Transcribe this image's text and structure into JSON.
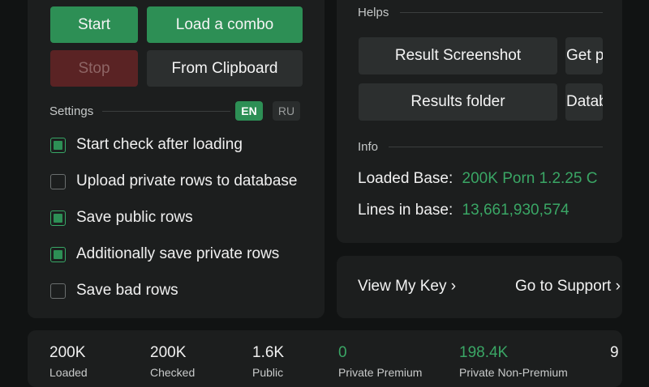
{
  "controls": {
    "start_label": "Start",
    "load_combo_label": "Load a combo",
    "stop_label": "Stop",
    "from_clipboard_label": "From Clipboard"
  },
  "settings": {
    "title": "Settings",
    "lang_en": "EN",
    "lang_ru": "RU",
    "options": [
      {
        "label": "Start check after loading",
        "checked": true
      },
      {
        "label": "Upload private rows to database",
        "checked": false
      },
      {
        "label": "Save public rows",
        "checked": true
      },
      {
        "label": "Additionally save private rows",
        "checked": true
      },
      {
        "label": "Save bad rows",
        "checked": false
      }
    ]
  },
  "helps": {
    "title": "Helps",
    "result_screenshot": "Result Screenshot",
    "get_p": "Get p",
    "results_folder": "Results folder",
    "datab": "Datab"
  },
  "info": {
    "title": "Info",
    "loaded_base_label": "Loaded Base:",
    "loaded_base_value": "200K Porn 1.2.25 C",
    "lines_label": "Lines in base:",
    "lines_value": "13,661,930,574"
  },
  "links": {
    "view_key": "View My Key ›",
    "support": "Go to Support ›"
  },
  "stats": [
    {
      "value": "200K",
      "label": "Loaded"
    },
    {
      "value": "200K",
      "label": "Checked"
    },
    {
      "value": "1.6K",
      "label": "Public"
    },
    {
      "value": "0",
      "label": "Private Premium"
    },
    {
      "value": "198.4K",
      "label": "Private Non-Premium"
    },
    {
      "value": "9",
      "label": ""
    }
  ],
  "colors": {
    "accent": "#2d8f55",
    "value_green": "#3aa665",
    "panel": "#1c1e1e",
    "background": "#111313"
  }
}
